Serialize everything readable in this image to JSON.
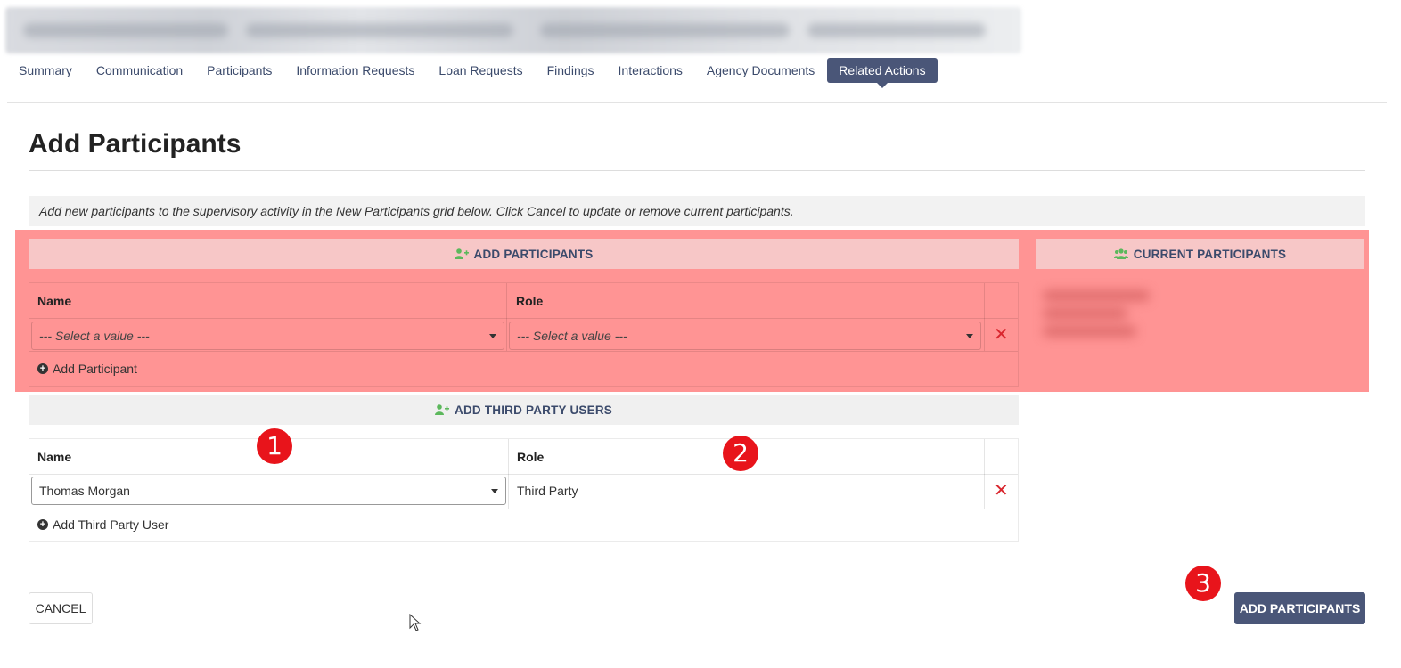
{
  "tabs": [
    {
      "label": "Summary"
    },
    {
      "label": "Communication"
    },
    {
      "label": "Participants"
    },
    {
      "label": "Information Requests"
    },
    {
      "label": "Loan Requests"
    },
    {
      "label": "Findings"
    },
    {
      "label": "Interactions"
    },
    {
      "label": "Agency Documents"
    },
    {
      "label": "Related Actions",
      "active": true
    }
  ],
  "page": {
    "title": "Add Participants",
    "info": "Add new participants to the supervisory activity in the New Participants grid below. Click Cancel to update or remove current participants."
  },
  "add_participants": {
    "header": "ADD PARTICIPANTS",
    "col_name": "Name",
    "col_role": "Role",
    "name_value": "--- Select a value ---",
    "role_value": "--- Select a value ---",
    "add_link": "Add Participant"
  },
  "current_participants": {
    "header": "CURRENT PARTICIPANTS"
  },
  "third_party": {
    "header": "ADD THIRD PARTY USERS",
    "col_name": "Name",
    "col_role": "Role",
    "name_value": "Thomas Morgan",
    "role_value": "Third Party",
    "add_link": "Add Third Party User"
  },
  "annotations": {
    "badge_1": "1",
    "badge_2": "2",
    "badge_3": "3"
  },
  "footer": {
    "cancel_label": "CANCEL",
    "submit_label": "ADD PARTICIPANTS"
  },
  "colors": {
    "primary": "#4a5678",
    "highlight": "#ff4646",
    "danger": "#d9262e",
    "badge": "#e8141b",
    "icon_green": "#5cb85c"
  },
  "icons": {
    "add_user": "user-plus-icon",
    "users": "users-icon",
    "remove": "close-icon",
    "add": "plus-circle-icon",
    "dropdown": "caret-down-icon"
  }
}
